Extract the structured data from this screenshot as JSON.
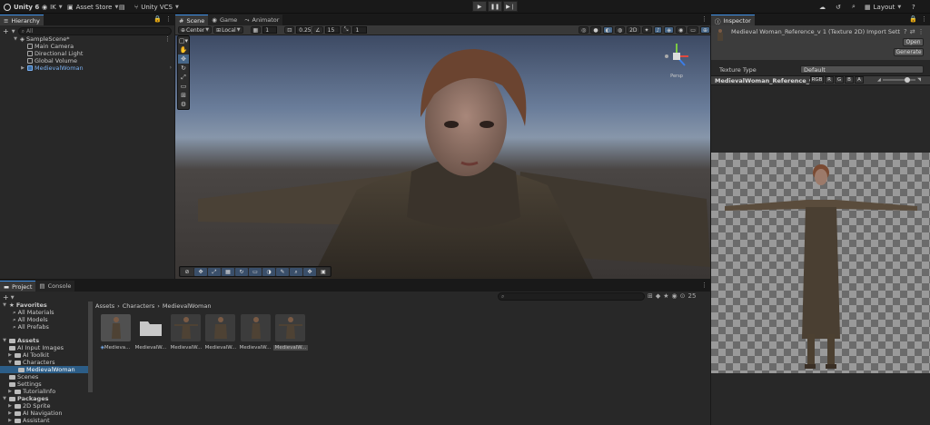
{
  "topbar": {
    "editor_name": "Unity 6",
    "account": "IK",
    "asset_store": "Asset Store",
    "vcs": "Unity VCS",
    "layout": "Layout"
  },
  "hierarchy": {
    "tab": "Hierarchy",
    "search_placeholder": "All",
    "scene_name": "SampleScene*",
    "items": [
      "Main Camera",
      "Directional Light",
      "Global Volume",
      "MedievalWoman"
    ]
  },
  "scene_view": {
    "tabs": [
      "Scene",
      "Game",
      "Animator"
    ],
    "pivot_mode": "Center",
    "pivot_rotation": "Local",
    "grid_value": "1",
    "snap_value": "0.25",
    "angle_value": "15",
    "scale_value": "1",
    "gizmo_label": "Persp"
  },
  "project": {
    "tabs": [
      "Project",
      "Console"
    ],
    "count": "25",
    "breadcrumb": [
      "Assets",
      "Characters",
      "MedievalWoman"
    ],
    "favorites_label": "Favorites",
    "favorites": [
      "All Materials",
      "All Models",
      "All Prefabs"
    ],
    "assets_label": "Assets",
    "asset_folders": [
      "AI Input Images",
      "AI Toolkit",
      "Characters",
      "MedievalWoman",
      "Scenes",
      "Settings",
      "TutorialInfo"
    ],
    "packages_label": "Packages",
    "packages": [
      "2D Sprite",
      "AI Navigation",
      "Assistant"
    ],
    "grid_items": [
      "Medieva...",
      "MedievalW...",
      "MedievalW...",
      "MedievalW...",
      "MedievalW...",
      "MedievalW..."
    ]
  },
  "inspector": {
    "tab": "Inspector",
    "title": "Medieval Woman_Reference_v 1 (Texture 2D) Import Settings",
    "open_button": "Open",
    "generate_button": "Generate",
    "texture_type_label": "Texture Type",
    "texture_type_value": "Default",
    "preview_name": "MedievalWoman_Reference_v1",
    "channels": [
      "RGB",
      "R",
      "G",
      "B",
      "A"
    ]
  },
  "colors": {
    "accent": "#3d8fe6",
    "selection": "#2c5d87",
    "panel": "#282828",
    "background": "#191919"
  }
}
